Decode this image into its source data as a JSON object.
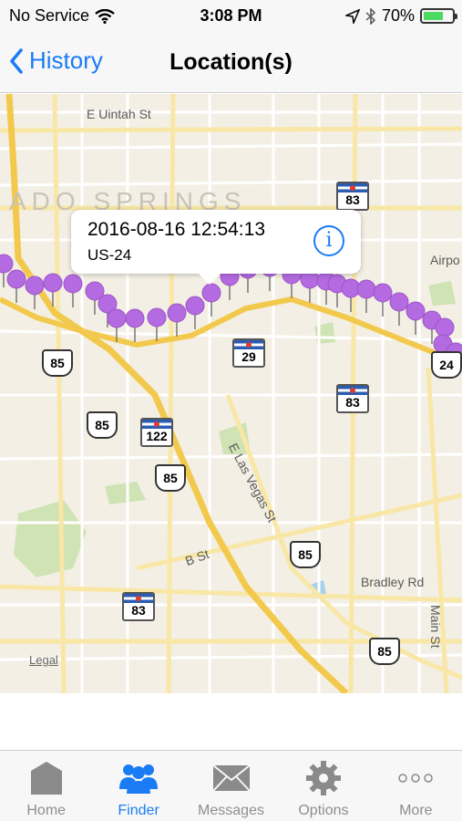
{
  "status_bar": {
    "carrier": "No Service",
    "time": "3:08 PM",
    "battery_percent": "70%",
    "battery_level": 0.7
  },
  "nav": {
    "back_label": "History",
    "title": "Location(s)"
  },
  "map": {
    "city_label": "ADO SPRINGS",
    "street_labels": {
      "uintah": "E Uintah St",
      "las_vegas": "E Las Vegas St",
      "b_st": "B St",
      "bradley": "Bradley Rd",
      "main": "Main St",
      "airport": "Airpo"
    },
    "shields": {
      "co83_top": "83",
      "co29": "29",
      "co83_mid": "83",
      "co122": "122",
      "co83_bottom": "83",
      "us85_a": "85",
      "us85_b": "85",
      "us85_c": "85",
      "us85_d": "85",
      "us85_e": "85",
      "us24": "24"
    },
    "legal": "Legal"
  },
  "callout": {
    "title": "2016-08-16 12:54:13",
    "subtitle": "US-24",
    "info_icon": "info-icon"
  },
  "tabs": [
    {
      "label": "Home",
      "icon": "home-icon",
      "active": false
    },
    {
      "label": "Finder",
      "icon": "people-icon",
      "active": true
    },
    {
      "label": "Messages",
      "icon": "envelope-icon",
      "active": false
    },
    {
      "label": "Options",
      "icon": "gear-icon",
      "active": false
    },
    {
      "label": "More",
      "icon": "more-icon",
      "active": false
    }
  ],
  "colors": {
    "accent": "#1a7cf5",
    "pin": "#b46ae0",
    "highway": "#f2c94c"
  }
}
